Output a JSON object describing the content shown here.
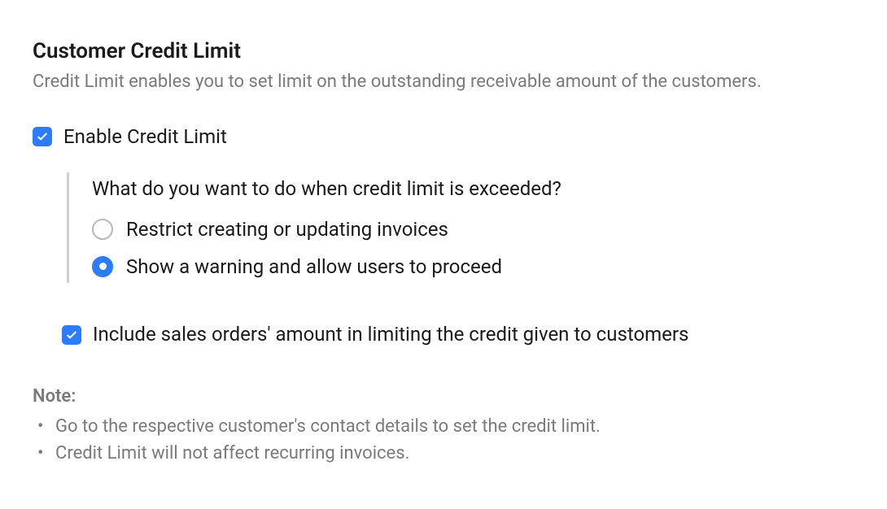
{
  "section": {
    "title": "Customer Credit Limit",
    "description": "Credit Limit enables you to set limit on the outstanding receivable amount of the customers."
  },
  "enable_credit_limit": {
    "label": "Enable Credit Limit",
    "checked": true
  },
  "exceed_behavior": {
    "question": "What do you want to do when credit limit is exceeded?",
    "options": [
      {
        "label": "Restrict creating or updating invoices",
        "selected": false
      },
      {
        "label": "Show a warning and allow users to proceed",
        "selected": true
      }
    ]
  },
  "include_sales_orders": {
    "label": "Include sales orders' amount in limiting the credit given to customers",
    "checked": true
  },
  "note": {
    "title": "Note:",
    "items": [
      "Go to the respective customer's contact details to set the credit limit.",
      "Credit Limit will not affect recurring invoices."
    ]
  },
  "colors": {
    "accent": "#2b7cff",
    "muted": "#7a7a7a"
  }
}
